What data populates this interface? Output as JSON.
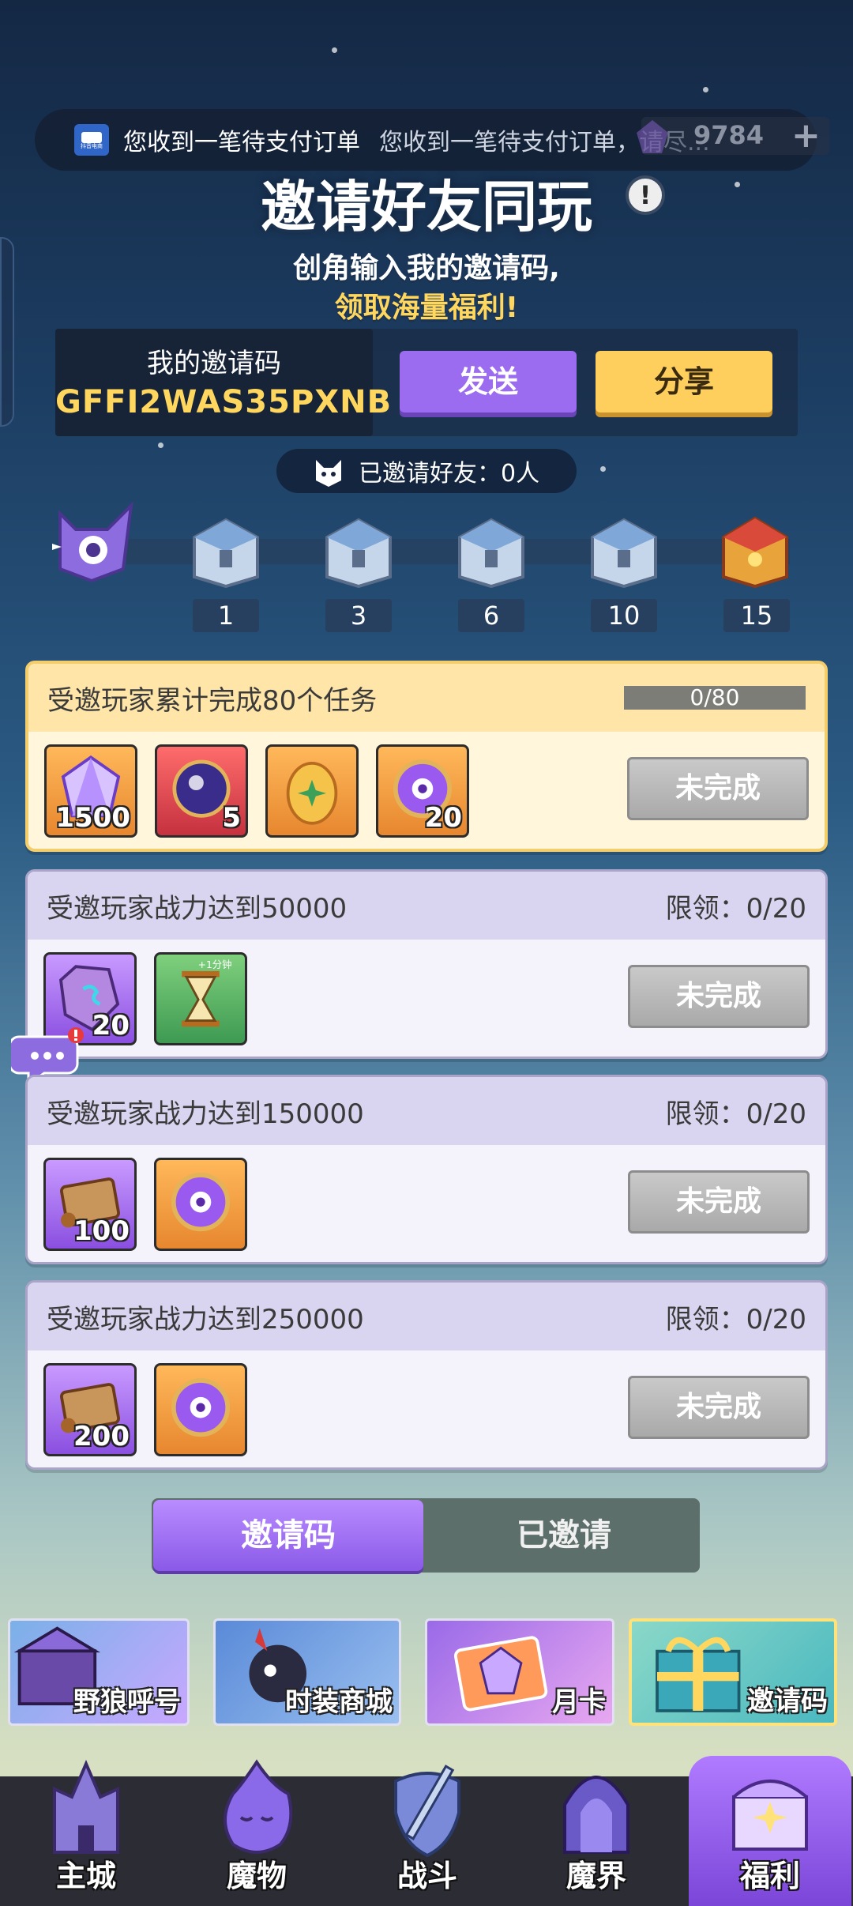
{
  "notification": {
    "app_badge": "抖音电商",
    "text": "您收到一笔待支付订单",
    "text_scroll": "您收到一笔待支付订单，请尽..."
  },
  "currency": {
    "count": "9784",
    "plus": "+"
  },
  "header": {
    "title": "邀请好友同玩",
    "info": "!",
    "subtitle1": "创角输入我的邀请码,",
    "subtitle2": "领取海量福利!"
  },
  "invite_code": {
    "label": "我的邀请码",
    "value": "GFFI2WAS35PXNB",
    "send_label": "发送",
    "share_label": "分享"
  },
  "invited_friends": "已邀请好友：0人",
  "milestones": [
    "1",
    "3",
    "6",
    "10",
    "15"
  ],
  "tasks": [
    {
      "title": "受邀玩家累计完成80个任务",
      "progress": "0/80",
      "rewards": [
        {
          "qty": "1500"
        },
        {
          "qty": "5"
        },
        {
          "qty": ""
        },
        {
          "qty": "20"
        }
      ],
      "status": "未完成"
    },
    {
      "title": "受邀玩家战力达到50000",
      "limit": "限领：0/20",
      "rewards": [
        {
          "qty": "20"
        },
        {
          "qty": "",
          "tag": "+1分钟"
        }
      ],
      "status": "未完成"
    },
    {
      "title": "受邀玩家战力达到150000",
      "limit": "限领：0/20",
      "rewards": [
        {
          "qty": "100"
        },
        {
          "qty": ""
        }
      ],
      "status": "未完成"
    },
    {
      "title": "受邀玩家战力达到250000",
      "limit": "限领：0/20",
      "rewards": [
        {
          "qty": "200"
        },
        {
          "qty": ""
        }
      ],
      "status": "未完成"
    }
  ],
  "tabs": {
    "code": "邀请码",
    "invited": "已邀请"
  },
  "banners": [
    "野狼呼号",
    "时装商城",
    "月卡",
    "邀请码"
  ],
  "nav": [
    "主城",
    "魔物",
    "战斗",
    "魔界",
    "福利"
  ],
  "colors": {
    "accent_purple": "#9b6cf0",
    "accent_gold": "#ffcf5e",
    "code_gold": "#ffd75e"
  }
}
